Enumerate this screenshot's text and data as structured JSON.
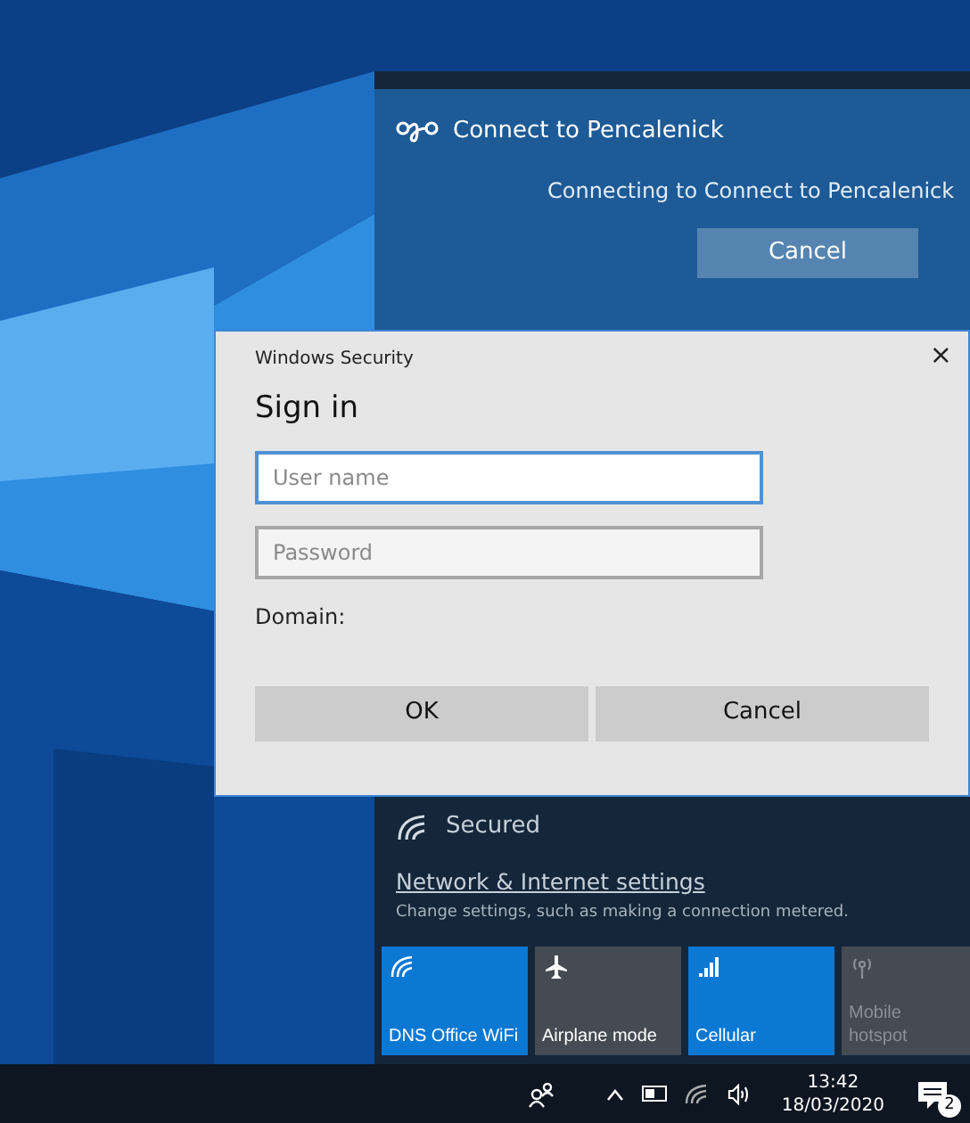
{
  "connect_card": {
    "title": "Connect to Pencalenick",
    "status": "Connecting to Connect to Pencalenick",
    "button": "Cancel"
  },
  "dialog": {
    "title": "Windows Security",
    "close": "×",
    "heading": "Sign in",
    "fields": [
      {
        "placeholder": "User name",
        "focused": true
      },
      {
        "placeholder": "Password",
        "focused": false
      }
    ],
    "domain_label": "Domain:",
    "buttons": [
      "OK",
      "Cancel"
    ]
  },
  "network": {
    "status": "Secured",
    "settings_link": "Network & Internet settings",
    "settings_hint": "Change settings, such as making a connection metered."
  },
  "quick_actions": [
    {
      "kind": "wifi",
      "label": "DNS Office WiFi",
      "on": true,
      "disabled": false
    },
    {
      "kind": "airplane",
      "label": "Airplane mode",
      "on": false,
      "disabled": false
    },
    {
      "kind": "cellular",
      "label": "Cellular",
      "on": true,
      "disabled": false
    },
    {
      "kind": "hotspot",
      "label": "Mobile hotspot",
      "on": false,
      "disabled": true
    }
  ],
  "taskbar": {
    "time": "13:42",
    "date": "18/03/2020",
    "notification_count": "2"
  }
}
